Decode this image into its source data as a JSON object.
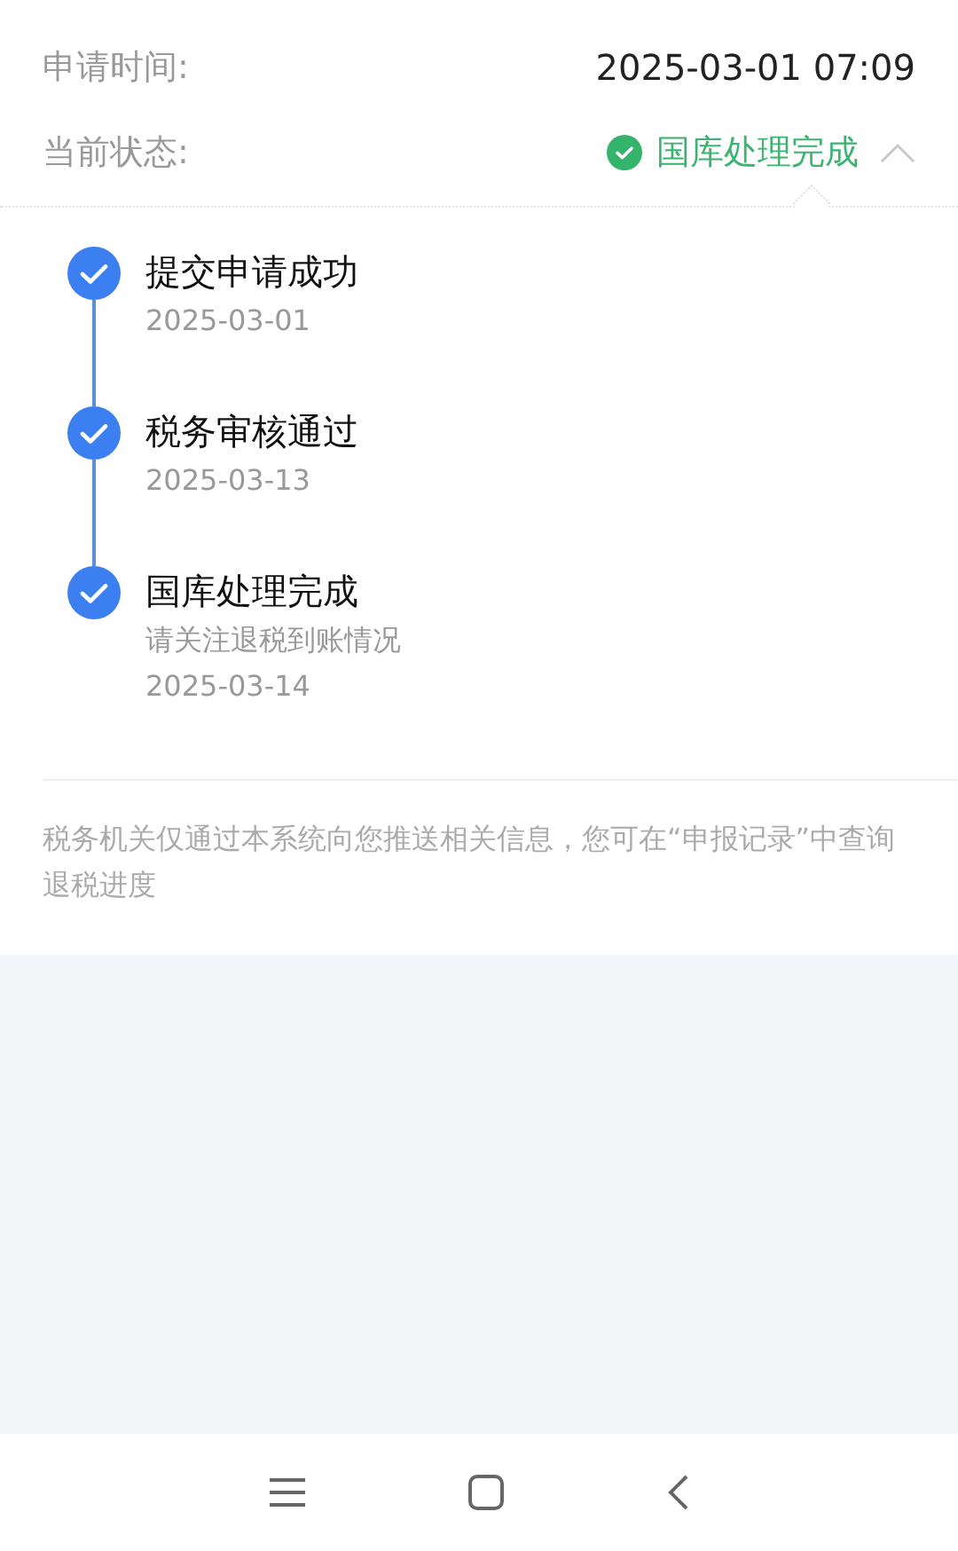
{
  "info_rows": [
    {
      "label": "申请时间:",
      "value": "2025-03-01 07:09",
      "kind": "text"
    },
    {
      "label": "当前状态:",
      "value": "国库处理完成",
      "kind": "status"
    }
  ],
  "status_expanded": true,
  "timeline": [
    {
      "title": "提交申请成功",
      "date": "2025-03-01",
      "done": true
    },
    {
      "title": "税务审核通过",
      "date": "2025-03-13",
      "done": true
    },
    {
      "title": "国库处理完成",
      "note": "请关注退税到账情况",
      "date": "2025-03-14",
      "done": true
    }
  ],
  "footnote": "税务机关仅通过本系统向您推送相关信息，您可在“申报记录”中查询退税进度"
}
